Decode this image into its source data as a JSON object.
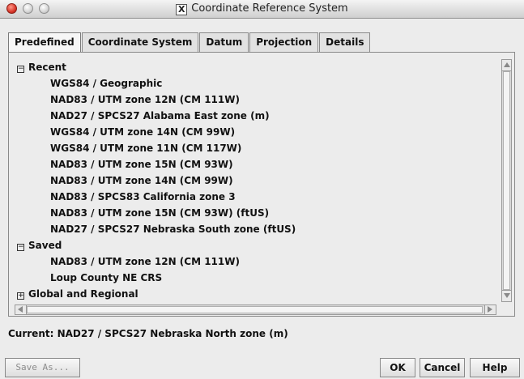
{
  "window": {
    "title": "Coordinate Reference System"
  },
  "tabs": [
    {
      "label": "Predefined",
      "active": true
    },
    {
      "label": "Coordinate System",
      "active": false
    },
    {
      "label": "Datum",
      "active": false
    },
    {
      "label": "Projection",
      "active": false
    },
    {
      "label": "Details",
      "active": false
    }
  ],
  "tree": {
    "groups": [
      {
        "label": "Recent",
        "expanded": true,
        "items": [
          "WGS84 / Geographic",
          "NAD83 / UTM zone 12N (CM 111W)",
          "NAD27 / SPCS27 Alabama East zone (m)",
          "WGS84 / UTM zone 14N (CM 99W)",
          "WGS84 / UTM zone 11N (CM 117W)",
          "NAD83 / UTM zone 15N (CM 93W)",
          "NAD83 / UTM zone 14N (CM 99W)",
          "NAD83 / SPCS83 California zone 3",
          "NAD83 / UTM zone 15N (CM 93W) (ftUS)",
          "NAD27 / SPCS27 Nebraska South zone (ftUS)"
        ]
      },
      {
        "label": "Saved",
        "expanded": true,
        "items": [
          "NAD83 / UTM zone 12N (CM 111W)",
          "Loup County NE CRS"
        ]
      },
      {
        "label": "Global and Regional",
        "expanded": false,
        "items": []
      }
    ],
    "expanded_symbol": "−",
    "collapsed_symbol": "+"
  },
  "status": {
    "current": "Current: NAD27 / SPCS27 Nebraska North zone (m)"
  },
  "buttons": {
    "save_as": "Save As...",
    "ok": "OK",
    "cancel": "Cancel",
    "help": "Help"
  }
}
